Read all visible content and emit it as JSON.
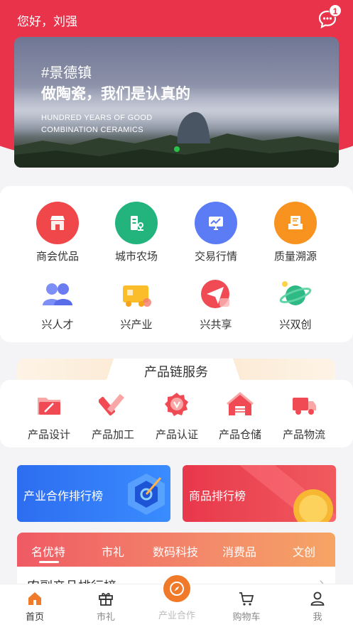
{
  "header": {
    "greeting": "您好，刘强",
    "notification_count": "1",
    "accent": "#e8334a"
  },
  "banner": {
    "tag": "#景德镇",
    "slogan": "做陶瓷，我们是认真的",
    "en_line1": "HUNDRED YEARS OF GOOD",
    "en_line2": "COMBINATION CERAMICS"
  },
  "grid": {
    "row1": [
      {
        "label": "商会优品",
        "icon": "shop-icon",
        "color": "#f0474a"
      },
      {
        "label": "城市农场",
        "icon": "farm-icon",
        "color": "#22b47c"
      },
      {
        "label": "交易行情",
        "icon": "chart-monitor-icon",
        "color": "#5b7cf5"
      },
      {
        "label": "质量溯源",
        "icon": "inbox-icon",
        "color": "#f7931e"
      }
    ],
    "row2": [
      {
        "label": "兴人才",
        "icon": "people-icon"
      },
      {
        "label": "兴产业",
        "icon": "truck-icon"
      },
      {
        "label": "兴共享",
        "icon": "paper-plane-icon"
      },
      {
        "label": "兴双创",
        "icon": "planet-icon"
      }
    ]
  },
  "services": {
    "title": "产品链服务",
    "items": [
      {
        "label": "产品设计",
        "icon": "folder-pen-icon"
      },
      {
        "label": "产品加工",
        "icon": "ruler-pencil-icon"
      },
      {
        "label": "产品认证",
        "icon": "badge-v-icon"
      },
      {
        "label": "产品仓储",
        "icon": "warehouse-icon"
      },
      {
        "label": "产品物流",
        "icon": "delivery-truck-icon"
      }
    ]
  },
  "rankings": {
    "left": "产业合作排行榜",
    "right": "商品排行榜"
  },
  "tabs": {
    "items": [
      "名优特",
      "市礼",
      "数码科技",
      "消费品",
      "文创"
    ],
    "active": "名优特",
    "sub_title": "农副产品排行榜"
  },
  "bottom_nav": {
    "items": [
      {
        "label": "首页",
        "icon": "home-icon"
      },
      {
        "label": "市礼",
        "icon": "gift-icon"
      },
      {
        "label": "产业合作",
        "icon": "compass-icon"
      },
      {
        "label": "购物车",
        "icon": "cart-icon"
      },
      {
        "label": "我",
        "icon": "user-icon"
      }
    ],
    "active": "首页",
    "accent": "#f07a2a"
  }
}
